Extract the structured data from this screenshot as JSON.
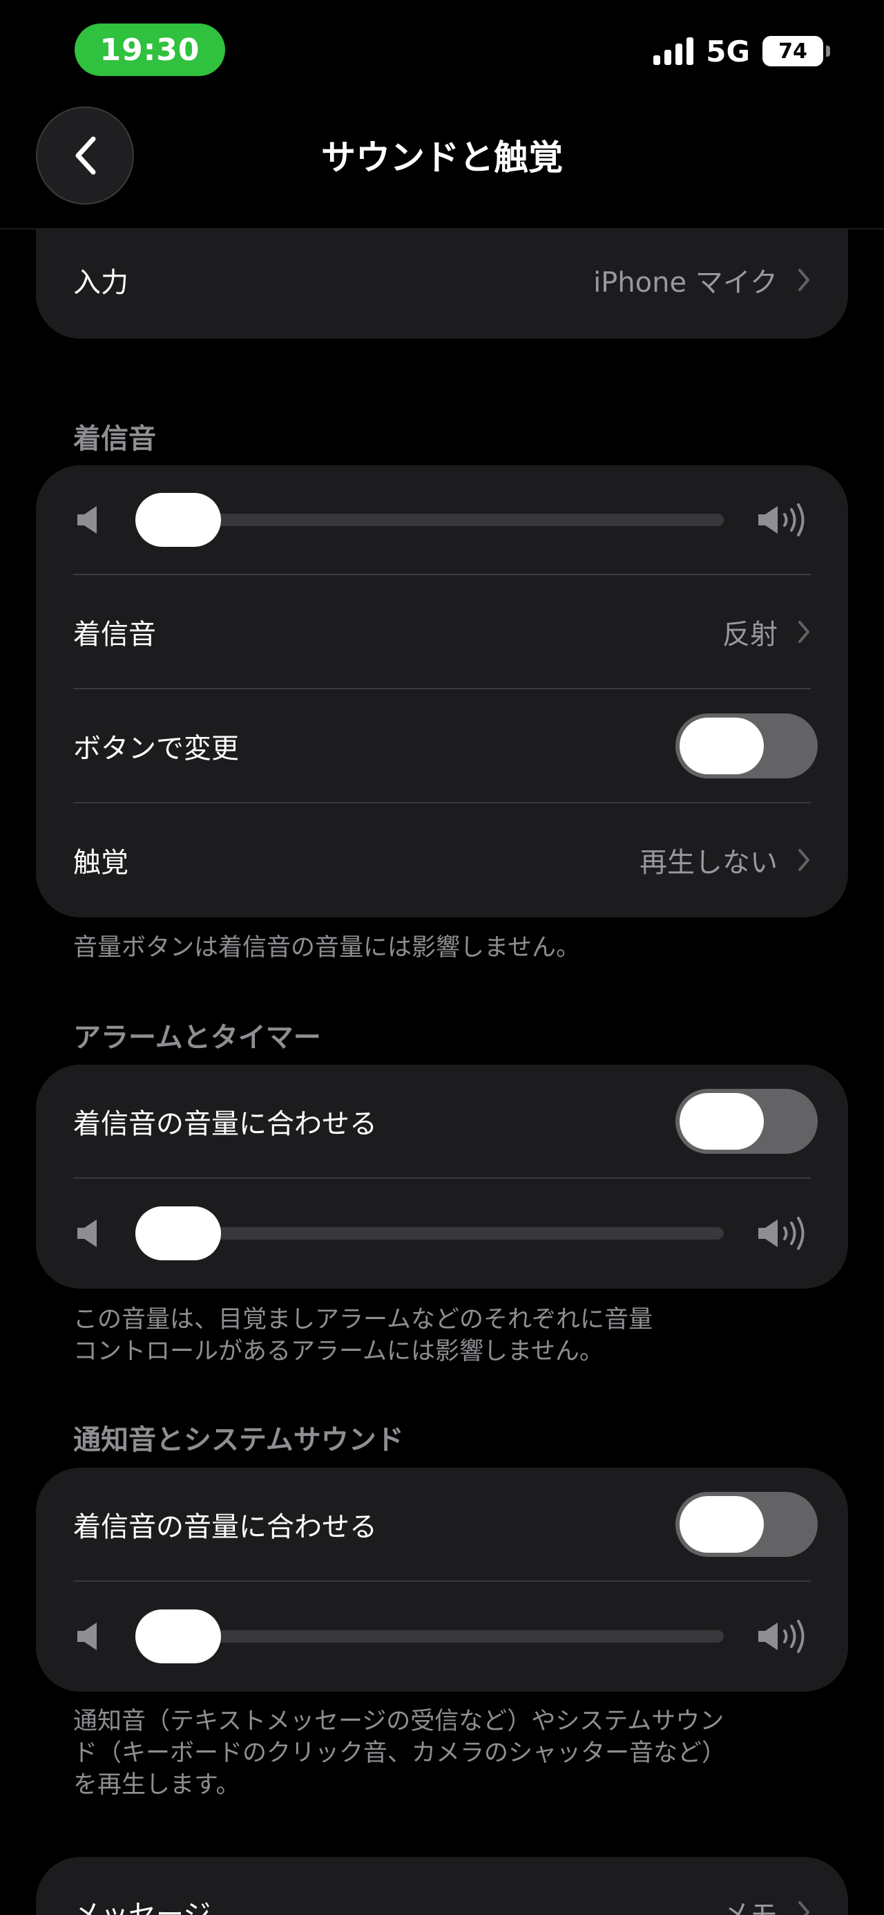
{
  "status_bar": {
    "time": "19:30",
    "network": "5G",
    "battery": "74",
    "signal_bars": 4
  },
  "nav": {
    "title": "サウンドと触覚"
  },
  "input_row": {
    "label": "入力",
    "value": "iPhone マイク"
  },
  "ringtone_section": {
    "header": "着信音",
    "volume_level": 0.0,
    "ringtone_label": "着信音",
    "ringtone_value": "反射",
    "change_with_buttons_label": "ボタンで変更",
    "change_with_buttons_on": false,
    "haptics_label": "触覚",
    "haptics_value": "再生しない",
    "footer": "音量ボタンは着信音の音量には影響しません。"
  },
  "alarm_section": {
    "header": "アラームとタイマー",
    "match_label": "着信音の音量に合わせる",
    "match_on": false,
    "volume_level": 0.0,
    "footer_line1": "この音量は、目覚ましアラームなどのそれぞれに音量",
    "footer_line2": "コントロールがあるアラームには影響しません。"
  },
  "notification_section": {
    "header": "通知音とシステムサウンド",
    "match_label": "着信音の音量に合わせる",
    "match_on": false,
    "volume_level": 0.0,
    "footer_line1": "通知音（テキストメッセージの受信など）やシステムサウン",
    "footer_line2": "ド（キーボードのクリック音、カメラのシャッター音など）",
    "footer_line3": "を再生します。"
  },
  "messages_row": {
    "label": "メッセージ",
    "value": "メモ"
  },
  "colors": {
    "accent_time": "#30c13f",
    "background": "#000000",
    "cell": "#1c1c1e",
    "secondary_text": "#8e8e93"
  }
}
